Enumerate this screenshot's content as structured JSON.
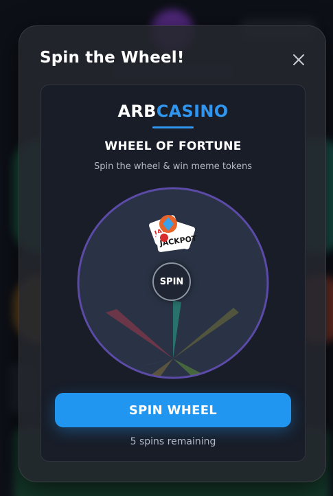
{
  "modal": {
    "title": "Spin the Wheel!",
    "close_icon": "close-icon"
  },
  "brand": {
    "part1": "ARB",
    "part2": "CASINO"
  },
  "wheel": {
    "heading": "WHEEL OF FORTUNE",
    "subtitle": "Spin the wheel & win meme tokens",
    "center_label": "SPIN",
    "token_labels": [
      "JACKPOT",
      "JACKPOT",
      "JACKPOT"
    ]
  },
  "actions": {
    "spin_button": "SPIN WHEEL",
    "spins_remaining": "5 spins remaining"
  },
  "colors": {
    "accent": "#2196f0",
    "brand_blue": "#2f95ee",
    "wheel_border": "#5b4aa6"
  }
}
